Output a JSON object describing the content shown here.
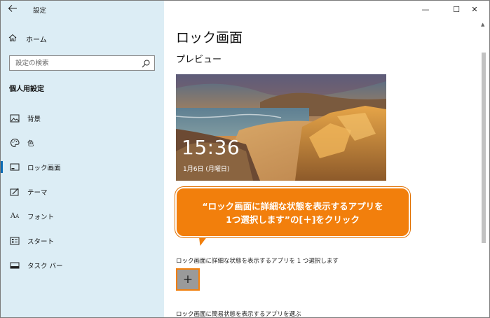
{
  "titlebar": {
    "app_title": "設定",
    "minimize": "—",
    "maximize": "☐",
    "close": "✕"
  },
  "sidebar": {
    "home_label": "ホーム",
    "search_placeholder": "設定の検索",
    "section_title": "個人用設定",
    "items": [
      {
        "label": "背景",
        "icon": "image-icon"
      },
      {
        "label": "色",
        "icon": "palette-icon"
      },
      {
        "label": "ロック画面",
        "icon": "lock-screen-icon",
        "active": true
      },
      {
        "label": "テーマ",
        "icon": "theme-icon"
      },
      {
        "label": "フォント",
        "icon": "font-icon"
      },
      {
        "label": "スタート",
        "icon": "start-icon"
      },
      {
        "label": "タスク バー",
        "icon": "taskbar-icon"
      }
    ]
  },
  "main": {
    "title": "ロック画面",
    "preview_heading": "プレビュー",
    "preview": {
      "time": "15:36",
      "date": "1月6日 (月曜日)"
    },
    "callout": {
      "line1": "“ロック画面に詳細な状態を表示するアプリを",
      "line2": "1つ選択します”の[＋]をクリック",
      "color": "#f27f0c"
    },
    "detail_app_label": "ロック画面に詳細な状態を表示するアプリを 1 つ選択します",
    "plus_label": "+",
    "quick_app_label": "ロック画面に簡易状態を表示するアプリを選ぶ"
  }
}
